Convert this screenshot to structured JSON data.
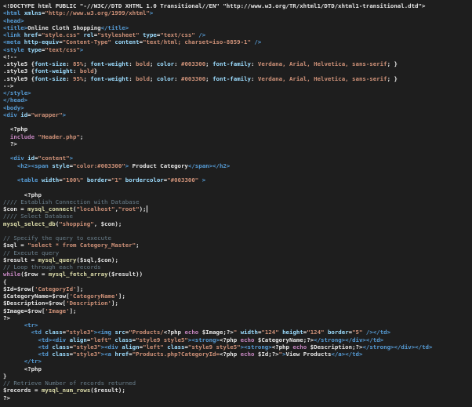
{
  "editor": {
    "lines": [
      [
        [
          "tx",
          "<!DOCTYPE html PUBLIC \"-//W3C//DTD XHTML 1.0 Transitional//EN\" \"http://www.w3.org/TR/xhtml1/DTD/xhtml1-transitional.dtd\">"
        ]
      ],
      [
        [
          "tg",
          "<html "
        ],
        [
          "at",
          "xmlns"
        ],
        [
          "tx",
          "="
        ],
        [
          "st",
          "\"http://www.w3.org/1999/xhtml\""
        ],
        [
          "tg",
          ">"
        ]
      ],
      [
        [
          "tg",
          "<head>"
        ]
      ],
      [
        [
          "tg",
          "<title>"
        ],
        [
          "tx",
          "Online Cloth Shopping"
        ],
        [
          "tg",
          "</title>"
        ]
      ],
      [
        [
          "tg",
          "<link "
        ],
        [
          "at",
          "href"
        ],
        [
          "tx",
          "="
        ],
        [
          "st",
          "\"style.css\""
        ],
        [
          "tx",
          " "
        ],
        [
          "at",
          "rel"
        ],
        [
          "tx",
          "="
        ],
        [
          "st",
          "\"stylesheet\""
        ],
        [
          "tx",
          " "
        ],
        [
          "at",
          "type"
        ],
        [
          "tx",
          "="
        ],
        [
          "st",
          "\"text/css\""
        ],
        [
          "tx",
          " "
        ],
        [
          "tg",
          "/>"
        ]
      ],
      [
        [
          "tg",
          "<meta "
        ],
        [
          "at",
          "http-equiv"
        ],
        [
          "tx",
          "="
        ],
        [
          "st",
          "\"Content-Type\""
        ],
        [
          "tx",
          " "
        ],
        [
          "at",
          "content"
        ],
        [
          "tx",
          "="
        ],
        [
          "st",
          "\"text/html; charset=iso-8859-1\""
        ],
        [
          "tx",
          " "
        ],
        [
          "tg",
          "/>"
        ]
      ],
      [
        [
          "tg",
          "<style "
        ],
        [
          "at",
          "type"
        ],
        [
          "tx",
          "="
        ],
        [
          "st",
          "\"text/css\""
        ],
        [
          "tg",
          ">"
        ]
      ],
      [
        [
          "tx",
          "<!--"
        ]
      ],
      [
        [
          "tx",
          ".style5 {"
        ],
        [
          "at",
          "font-size"
        ],
        [
          "tx",
          ": "
        ],
        [
          "st",
          "85%"
        ],
        [
          "tx",
          "; "
        ],
        [
          "at",
          "font-weight"
        ],
        [
          "tx",
          ": "
        ],
        [
          "st",
          "bold"
        ],
        [
          "tx",
          "; "
        ],
        [
          "at",
          "color"
        ],
        [
          "tx",
          ": "
        ],
        [
          "st",
          "#003300"
        ],
        [
          "tx",
          "; "
        ],
        [
          "at",
          "font-family"
        ],
        [
          "tx",
          ": "
        ],
        [
          "st",
          "Verdana, Arial, Helvetica, sans-serif"
        ],
        [
          "tx",
          "; }"
        ]
      ],
      [
        [
          "tx",
          ".style3 {"
        ],
        [
          "at",
          "font-weight"
        ],
        [
          "tx",
          ": "
        ],
        [
          "st",
          "bold"
        ],
        [
          "tx",
          "}"
        ]
      ],
      [
        [
          "tx",
          ".style9 {"
        ],
        [
          "at",
          "font-size"
        ],
        [
          "tx",
          ": "
        ],
        [
          "st",
          "95%"
        ],
        [
          "tx",
          "; "
        ],
        [
          "at",
          "font-weight"
        ],
        [
          "tx",
          ": "
        ],
        [
          "st",
          "bold"
        ],
        [
          "tx",
          "; "
        ],
        [
          "at",
          "color"
        ],
        [
          "tx",
          ": "
        ],
        [
          "st",
          "#003300"
        ],
        [
          "tx",
          "; "
        ],
        [
          "at",
          "font-family"
        ],
        [
          "tx",
          ": "
        ],
        [
          "st",
          "Verdana, Arial, Helvetica, sans-serif"
        ],
        [
          "tx",
          "; }"
        ]
      ],
      [
        [
          "tx",
          "-->"
        ]
      ],
      [
        [
          "tg",
          "</style>"
        ]
      ],
      [
        [
          "tg",
          "</head>"
        ]
      ],
      [
        [
          "tg",
          "<body>"
        ]
      ],
      [
        [
          "tg",
          "<div "
        ],
        [
          "at",
          "id"
        ],
        [
          "tx",
          "="
        ],
        [
          "st",
          "\"wrapper\""
        ],
        [
          "tg",
          ">"
        ]
      ],
      [
        [
          "tx",
          ""
        ]
      ],
      [
        [
          "tx",
          "  "
        ],
        [
          "ph",
          "<?php"
        ]
      ],
      [
        [
          "tx",
          "  "
        ],
        [
          "kw",
          "include"
        ],
        [
          "tx",
          " "
        ],
        [
          "st",
          "\"Header.php\""
        ],
        [
          "tx",
          ";"
        ]
      ],
      [
        [
          "tx",
          "  "
        ],
        [
          "ph",
          "?>"
        ]
      ],
      [
        [
          "tx",
          ""
        ]
      ],
      [
        [
          "tx",
          "  "
        ],
        [
          "tg",
          "<div "
        ],
        [
          "at",
          "id"
        ],
        [
          "tx",
          "="
        ],
        [
          "st",
          "\"content\""
        ],
        [
          "tg",
          ">"
        ]
      ],
      [
        [
          "tx",
          "    "
        ],
        [
          "tg",
          "<h2>"
        ],
        [
          "tg",
          "<span "
        ],
        [
          "at",
          "style"
        ],
        [
          "tx",
          "="
        ],
        [
          "st",
          "\"color:#003300\""
        ],
        [
          "tg",
          ">"
        ],
        [
          "tx",
          " Product Category"
        ],
        [
          "tg",
          "</span>"
        ],
        [
          "tg",
          "</h2>"
        ]
      ],
      [
        [
          "tx",
          ""
        ]
      ],
      [
        [
          "tx",
          "    "
        ],
        [
          "tg",
          "<table "
        ],
        [
          "at",
          "width"
        ],
        [
          "tx",
          "="
        ],
        [
          "st",
          "\"100%\""
        ],
        [
          "tx",
          " "
        ],
        [
          "at",
          "border"
        ],
        [
          "tx",
          "="
        ],
        [
          "st",
          "\"1\""
        ],
        [
          "tx",
          " "
        ],
        [
          "at",
          "bordercolor"
        ],
        [
          "tx",
          "="
        ],
        [
          "st",
          "\"#003300\""
        ],
        [
          "tx",
          " "
        ],
        [
          "tg",
          ">"
        ]
      ],
      [
        [
          "tx",
          ""
        ]
      ],
      [
        [
          "tx",
          "      "
        ],
        [
          "ph",
          "<?php"
        ]
      ],
      [
        [
          "cm",
          "//// Establish Connection with Database"
        ]
      ],
      [
        [
          "vr",
          "$con"
        ],
        [
          "tx",
          " = "
        ],
        [
          "fn",
          "mysql_connect"
        ],
        [
          "tx",
          "("
        ],
        [
          "st",
          "\"localhost\""
        ],
        [
          "tx",
          ","
        ],
        [
          "st",
          "\"root\""
        ],
        [
          "tx",
          ");"
        ]
      ],
      [
        [
          "cm",
          "//// Select Database"
        ]
      ],
      [
        [
          "fn",
          "mysql_select_db"
        ],
        [
          "tx",
          "("
        ],
        [
          "st",
          "\"shopping\""
        ],
        [
          "tx",
          ", "
        ],
        [
          "vr",
          "$con"
        ],
        [
          "tx",
          ");"
        ]
      ],
      [
        [
          "tx",
          ""
        ]
      ],
      [
        [
          "cm",
          "// Specify the query to execute"
        ]
      ],
      [
        [
          "vr",
          "$sql"
        ],
        [
          "tx",
          " = "
        ],
        [
          "st",
          "\"select * from Category_Master\""
        ],
        [
          "tx",
          ";"
        ]
      ],
      [
        [
          "cm",
          "// Execute query"
        ]
      ],
      [
        [
          "vr",
          "$result"
        ],
        [
          "tx",
          " = "
        ],
        [
          "fn",
          "mysql_query"
        ],
        [
          "tx",
          "("
        ],
        [
          "vr",
          "$sql"
        ],
        [
          "tx",
          ","
        ],
        [
          "vr",
          "$con"
        ],
        [
          "tx",
          ");"
        ]
      ],
      [
        [
          "cm",
          "// Loop through each records"
        ]
      ],
      [
        [
          "kw",
          "while"
        ],
        [
          "tx",
          "("
        ],
        [
          "vr",
          "$row"
        ],
        [
          "tx",
          " = "
        ],
        [
          "fn",
          "mysql_fetch_array"
        ],
        [
          "tx",
          "("
        ],
        [
          "vr",
          "$result"
        ],
        [
          "tx",
          "))"
        ]
      ],
      [
        [
          "tx",
          "{"
        ]
      ],
      [
        [
          "vr",
          "$Id"
        ],
        [
          "tx",
          "="
        ],
        [
          "vr",
          "$row"
        ],
        [
          "tx",
          "["
        ],
        [
          "st",
          "'CategoryId'"
        ],
        [
          "tx",
          "];"
        ]
      ],
      [
        [
          "vr",
          "$CategoryName"
        ],
        [
          "tx",
          "="
        ],
        [
          "vr",
          "$row"
        ],
        [
          "tx",
          "["
        ],
        [
          "st",
          "'CategoryName'"
        ],
        [
          "tx",
          "];"
        ]
      ],
      [
        [
          "vr",
          "$Description"
        ],
        [
          "tx",
          "="
        ],
        [
          "vr",
          "$row"
        ],
        [
          "tx",
          "["
        ],
        [
          "st",
          "'Description'"
        ],
        [
          "tx",
          "];"
        ]
      ],
      [
        [
          "vr",
          "$Image"
        ],
        [
          "tx",
          "="
        ],
        [
          "vr",
          "$row"
        ],
        [
          "tx",
          "["
        ],
        [
          "st",
          "'Image'"
        ],
        [
          "tx",
          "];"
        ]
      ],
      [
        [
          "ph",
          "?>"
        ]
      ],
      [
        [
          "tx",
          "      "
        ],
        [
          "tg",
          "<tr>"
        ]
      ],
      [
        [
          "tx",
          "        "
        ],
        [
          "tg",
          "<td "
        ],
        [
          "at",
          "class"
        ],
        [
          "tx",
          "="
        ],
        [
          "st",
          "\"style3\""
        ],
        [
          "tg",
          ">"
        ],
        [
          "tg",
          "<img "
        ],
        [
          "at",
          "src"
        ],
        [
          "tx",
          "="
        ],
        [
          "st",
          "\"Products/"
        ],
        [
          "ph",
          "<?php "
        ],
        [
          "kw",
          "echo"
        ],
        [
          "tx",
          " "
        ],
        [
          "vr",
          "$Image"
        ],
        [
          "tx",
          ";"
        ],
        [
          "ph",
          "?>"
        ],
        [
          "st",
          "\""
        ],
        [
          "tx",
          " "
        ],
        [
          "at",
          "width"
        ],
        [
          "tx",
          "="
        ],
        [
          "st",
          "\"124\""
        ],
        [
          "tx",
          " "
        ],
        [
          "at",
          "height"
        ],
        [
          "tx",
          "="
        ],
        [
          "st",
          "\"124\""
        ],
        [
          "tx",
          " "
        ],
        [
          "at",
          "border"
        ],
        [
          "tx",
          "="
        ],
        [
          "st",
          "\"5\""
        ],
        [
          "tx",
          " "
        ],
        [
          "tg",
          "/></td>"
        ]
      ],
      [
        [
          "tx",
          "          "
        ],
        [
          "tg",
          "<td>"
        ],
        [
          "tg",
          "<div "
        ],
        [
          "at",
          "align"
        ],
        [
          "tx",
          "="
        ],
        [
          "st",
          "\"left\""
        ],
        [
          "tx",
          " "
        ],
        [
          "at",
          "class"
        ],
        [
          "tx",
          "="
        ],
        [
          "st",
          "\"style9 style5\""
        ],
        [
          "tg",
          ">"
        ],
        [
          "tg",
          "<strong>"
        ],
        [
          "ph",
          "<?php "
        ],
        [
          "kw",
          "echo"
        ],
        [
          "tx",
          " "
        ],
        [
          "vr",
          "$CategoryName"
        ],
        [
          "tx",
          ";"
        ],
        [
          "ph",
          "?>"
        ],
        [
          "tg",
          "</strong></div></td>"
        ]
      ],
      [
        [
          "tx",
          "          "
        ],
        [
          "tg",
          "<td "
        ],
        [
          "at",
          "class"
        ],
        [
          "tx",
          "="
        ],
        [
          "st",
          "\"style3\""
        ],
        [
          "tg",
          ">"
        ],
        [
          "tg",
          "<div "
        ],
        [
          "at",
          "align"
        ],
        [
          "tx",
          "="
        ],
        [
          "st",
          "\"left\""
        ],
        [
          "tx",
          " "
        ],
        [
          "at",
          "class"
        ],
        [
          "tx",
          "="
        ],
        [
          "st",
          "\"style9 style5\""
        ],
        [
          "tg",
          ">"
        ],
        [
          "tg",
          "<strong>"
        ],
        [
          "ph",
          "<?php "
        ],
        [
          "kw",
          "echo"
        ],
        [
          "tx",
          " "
        ],
        [
          "vr",
          "$Description"
        ],
        [
          "tx",
          ";"
        ],
        [
          "ph",
          "?>"
        ],
        [
          "tg",
          "</strong></div></td>"
        ]
      ],
      [
        [
          "tx",
          "          "
        ],
        [
          "tg",
          "<td "
        ],
        [
          "at",
          "class"
        ],
        [
          "tx",
          "="
        ],
        [
          "st",
          "\"style3\""
        ],
        [
          "tg",
          ">"
        ],
        [
          "tg",
          "<a "
        ],
        [
          "at",
          "href"
        ],
        [
          "tx",
          "="
        ],
        [
          "st",
          "\"Products.php?CategoryId="
        ],
        [
          "ph",
          "<?php "
        ],
        [
          "kw",
          "echo"
        ],
        [
          "tx",
          " "
        ],
        [
          "vr",
          "$Id"
        ],
        [
          "tx",
          ";"
        ],
        [
          "ph",
          "?>"
        ],
        [
          "st",
          "\""
        ],
        [
          "tg",
          ">"
        ],
        [
          "tx",
          "View Products"
        ],
        [
          "tg",
          "</a></td>"
        ]
      ],
      [
        [
          "tx",
          "      "
        ],
        [
          "tg",
          "</tr>"
        ]
      ],
      [
        [
          "tx",
          "      "
        ],
        [
          "ph",
          "<?php"
        ]
      ],
      [
        [
          "tx",
          "}"
        ]
      ],
      [
        [
          "cm",
          "// Retrieve Number of records returned"
        ]
      ],
      [
        [
          "vr",
          "$records"
        ],
        [
          "tx",
          " = "
        ],
        [
          "fn",
          "mysql_num_rows"
        ],
        [
          "tx",
          "("
        ],
        [
          "vr",
          "$result"
        ],
        [
          "tx",
          ");"
        ]
      ],
      [
        [
          "ph",
          "?>"
        ]
      ]
    ]
  }
}
